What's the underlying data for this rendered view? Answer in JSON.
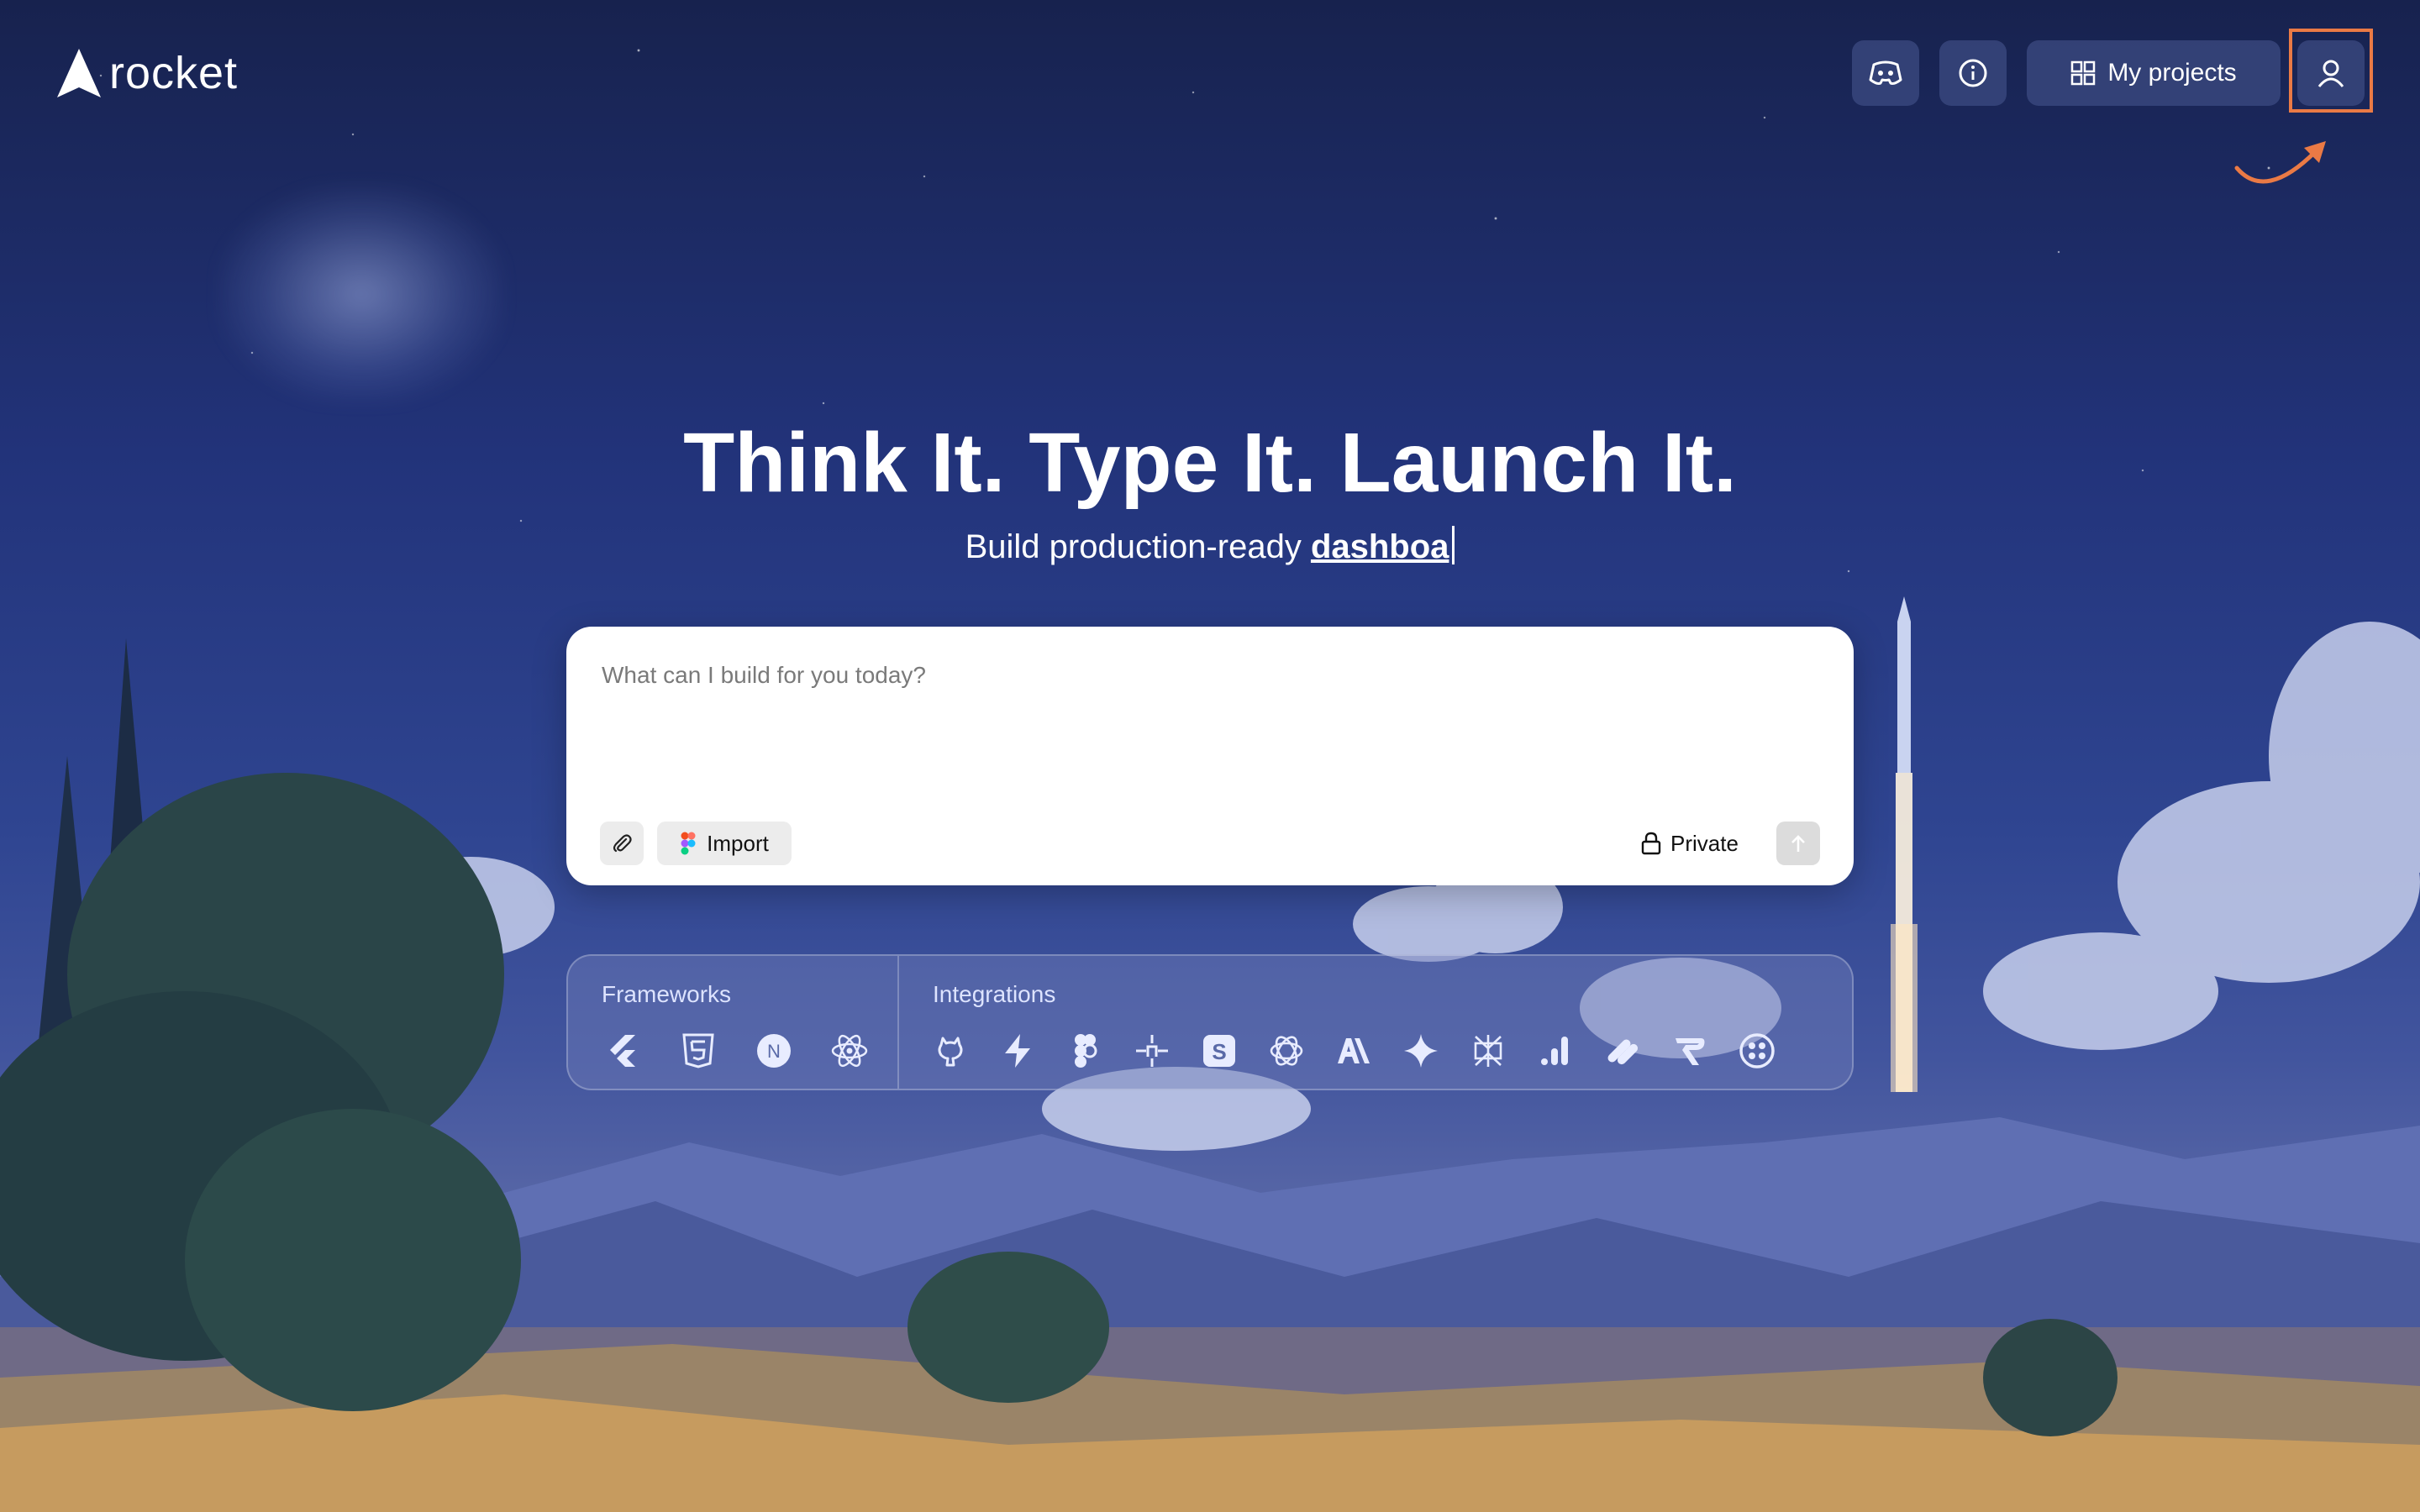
{
  "brand": {
    "name": "rocket"
  },
  "header": {
    "discord_icon": "discord-icon",
    "info_icon": "info-icon",
    "my_projects_label": "My projects",
    "user_icon": "user-icon"
  },
  "hero": {
    "title": "Think It. Type It. Launch It.",
    "subtitle_prefix": "Build production-ready ",
    "subtitle_typed": "dashboa"
  },
  "prompt": {
    "placeholder": "What can I build for you today?",
    "value": "",
    "import_label": "Import",
    "private_label": "Private"
  },
  "tech": {
    "frameworks_label": "Frameworks",
    "integrations_label": "Integrations",
    "frameworks": [
      "flutter-icon",
      "html5-icon",
      "nextjs-icon",
      "react-icon"
    ],
    "integrations": [
      "github-icon",
      "supabase-icon",
      "figma-icon",
      "mcp-icon",
      "stripe-icon",
      "openai-icon",
      "anthropic-icon",
      "gemini-icon",
      "perplexity-icon",
      "analytics-icon",
      "resend-icon",
      "razorpay-icon",
      "twilio-icon"
    ]
  },
  "colors": {
    "highlight": "#ea7a45",
    "card_bg": "#ffffff",
    "sky_top": "#17224e"
  }
}
